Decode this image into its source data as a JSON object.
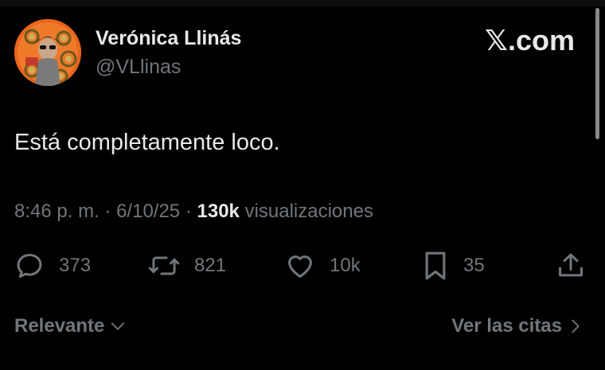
{
  "author": {
    "name": "Verónica Llinás",
    "handle": "@VLlinas"
  },
  "brand": {
    "x_glyph": "𝕏",
    "suffix": ".com"
  },
  "tweet": {
    "text": "Está completamente loco.",
    "time": "8:46 p. m.",
    "date": "6/10/25",
    "separator": "·",
    "views_count": "130k",
    "views_label": "visualizaciones"
  },
  "actions": {
    "replies": "373",
    "reposts": "821",
    "likes": "10k",
    "bookmarks": "35"
  },
  "footer": {
    "sort_label": "Relevante",
    "quotes_label": "Ver las citas"
  },
  "icons": {
    "reply": "reply-icon",
    "repost": "repost-icon",
    "like": "heart-icon",
    "bookmark": "bookmark-icon",
    "share": "share-icon",
    "sort": "chevron-down-icon",
    "quotes": "chevron-right-icon"
  },
  "colors": {
    "background": "#000000",
    "text_primary": "#e7e9ea",
    "text_secondary": "#71767b",
    "avatar_bg": "#e8651c"
  }
}
